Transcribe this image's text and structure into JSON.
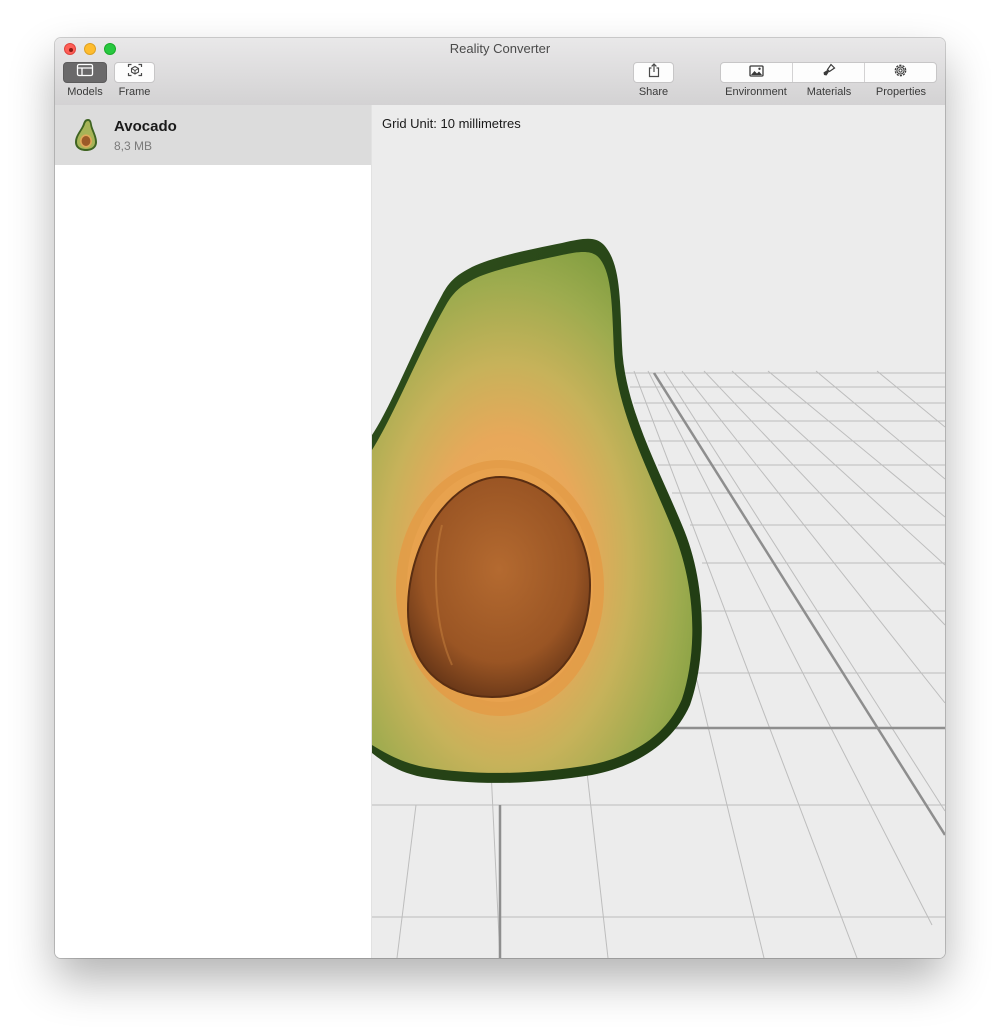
{
  "window": {
    "title": "Reality Converter"
  },
  "toolbar": {
    "models_label": "Models",
    "frame_label": "Frame",
    "share_label": "Share",
    "environment_label": "Environment",
    "materials_label": "Materials",
    "properties_label": "Properties"
  },
  "sidebar": {
    "items": [
      {
        "name": "Avocado",
        "size": "8,3 MB",
        "icon": "avocado-thumbnail"
      }
    ]
  },
  "viewport": {
    "grid_unit_text": "Grid Unit: 10 millimetres",
    "model": "avocado"
  },
  "colors": {
    "selected_row": "#dcdcdc",
    "viewport_bg": "#ececec",
    "avocado_skin": "#2f4f1c",
    "avocado_flesh": "#8fa84a",
    "avocado_ring": "#e3a24a",
    "avocado_pit": "#a45f2a"
  }
}
